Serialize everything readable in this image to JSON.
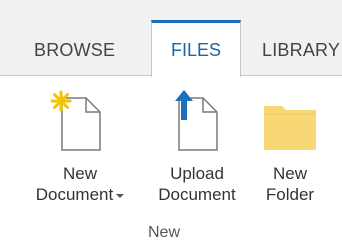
{
  "tabs": [
    {
      "label": "BROWSE"
    },
    {
      "label": "FILES"
    },
    {
      "label": "LIBRARY"
    }
  ],
  "selected_tab": "FILES",
  "commands": {
    "new_document": {
      "line1": "New",
      "line2": "Document",
      "icon": "new-document-icon"
    },
    "upload_document": {
      "line1": "Upload",
      "line2": "Document",
      "icon": "upload-document-icon"
    },
    "new_folder": {
      "line1": "New",
      "line2": "Folder",
      "icon": "folder-icon"
    }
  },
  "group": {
    "label": "New"
  },
  "colors": {
    "accent": "#1c6fb8",
    "star": "#f5c400",
    "folder": "#f8d775"
  }
}
